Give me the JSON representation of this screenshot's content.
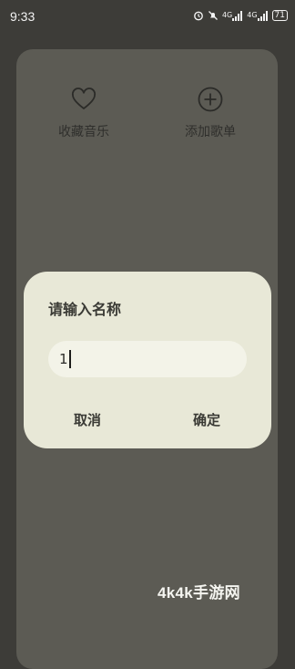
{
  "status_bar": {
    "time": "9:33",
    "network_left": "4G",
    "network_right": "4G",
    "battery": "71",
    "icons": [
      "alarm-icon",
      "mute-icon",
      "signal-icon",
      "signal-icon",
      "battery-icon"
    ]
  },
  "sheet": {
    "actions": [
      {
        "label": "收藏音乐",
        "icon": "heart-icon"
      },
      {
        "label": "添加歌单",
        "icon": "plus-circle-icon"
      }
    ]
  },
  "dialog": {
    "title": "请输入名称",
    "input_value": "1",
    "cancel_label": "取消",
    "confirm_label": "确定"
  },
  "watermark": "4k4k手游网",
  "colors": {
    "background": "#3d3c38",
    "sheet": "#5c5b54",
    "dialog": "#e8e8d7",
    "input": "#f3f3e8"
  }
}
